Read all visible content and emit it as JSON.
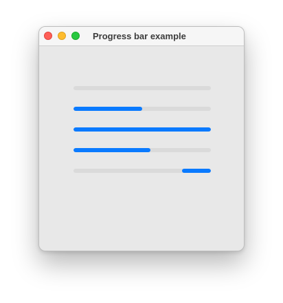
{
  "window": {
    "title": "Progress bar example",
    "controls": [
      "close-button",
      "minimize-button",
      "zoom-button"
    ]
  },
  "progress_bars": [
    {
      "kind": "determinate",
      "value": 0.0
    },
    {
      "kind": "determinate",
      "value": 0.5
    },
    {
      "kind": "determinate",
      "value": 1.0
    },
    {
      "kind": "determinate",
      "value": 0.56
    },
    {
      "kind": "indeterminate",
      "segment_start": 0.79,
      "segment_end": 1.0
    }
  ],
  "colors": {
    "accent": "#0a7aff",
    "track": "#dadada",
    "window_background": "#e8e8e8",
    "close": "#fe5f57",
    "minimize": "#febc2e",
    "zoom": "#28c840"
  }
}
